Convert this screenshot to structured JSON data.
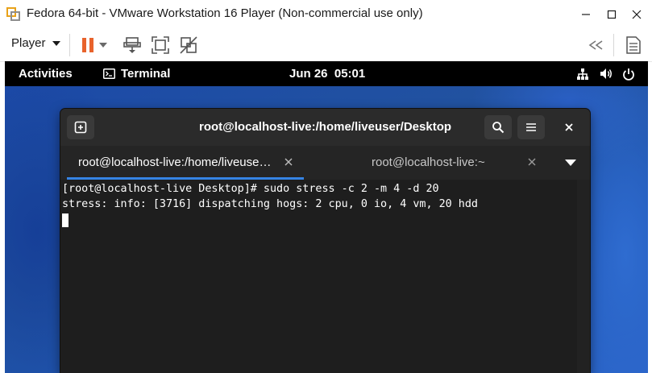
{
  "host_window": {
    "title": "Fedora 64-bit - VMware Workstation 16 Player (Non-commercial use only)"
  },
  "player_toolbar": {
    "player_menu_label": "Player"
  },
  "guest_topbar": {
    "activities_label": "Activities",
    "app_label": "Terminal",
    "clock": "Jun 26  05:01"
  },
  "terminal": {
    "title": "root@localhost-live:/home/liveuser/Desktop",
    "tabs": [
      {
        "label": "root@localhost-live:/home/liveuse…",
        "active": true
      },
      {
        "label": "root@localhost-live:~",
        "active": false
      }
    ],
    "lines": [
      "[root@localhost-live Desktop]# sudo stress -c 2 -m 4 -d 20",
      "stress: info: [3716] dispatching hogs: 2 cpu, 0 io, 4 vm, 20 hdd"
    ]
  },
  "colors": {
    "accent_pause": "#e8632c",
    "tab_underline": "#3584e4",
    "desktop_blue": "#1d4aa6"
  },
  "icons": [
    "vmware-logo-icon",
    "minimize-icon",
    "maximize-icon",
    "close-icon",
    "pause-icon",
    "send-ctrl-alt-del-icon",
    "fit-guest-icon",
    "unity-icon",
    "collapse-toolbar-icon",
    "message-log-icon",
    "terminal-app-icon",
    "network-icon",
    "volume-icon",
    "power-icon",
    "new-tab-icon",
    "search-icon",
    "hamburger-menu-icon",
    "tab-close-icon",
    "tabs-dropdown-icon"
  ]
}
